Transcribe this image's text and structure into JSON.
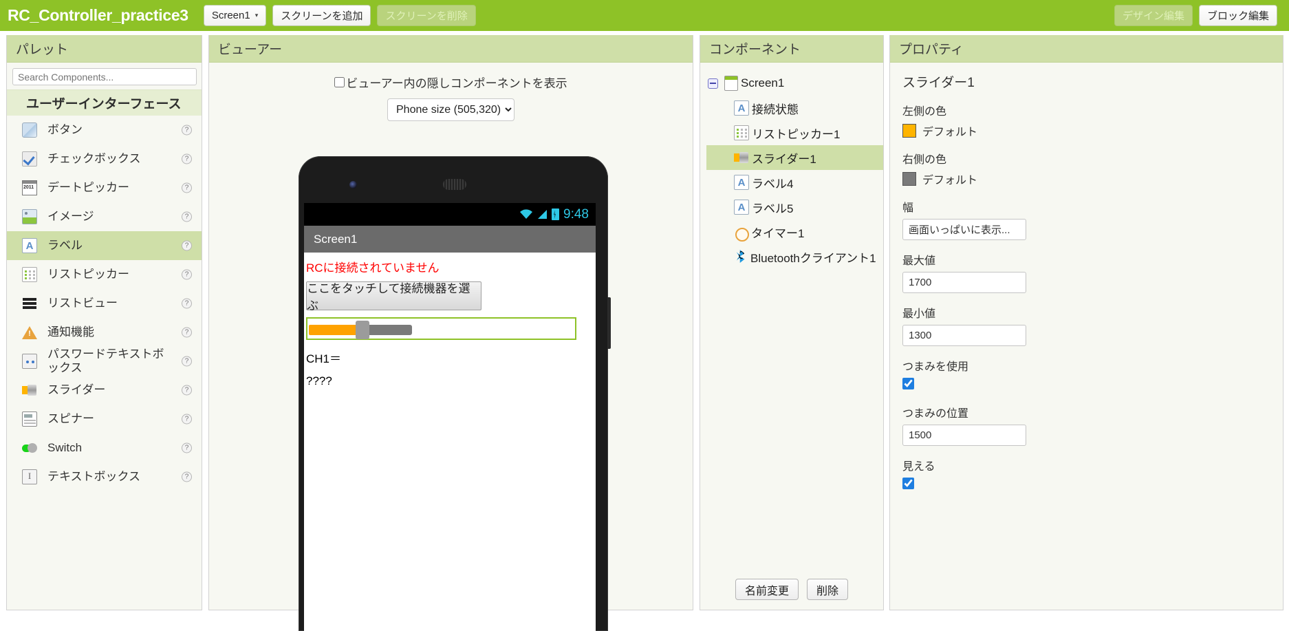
{
  "topbar": {
    "project_title": "RC_Controller_practice3",
    "screen_selector": "Screen1",
    "screen_caret": "▾",
    "add_screen": "スクリーンを追加",
    "remove_screen": "スクリーンを削除",
    "designer": "デザイン編集",
    "blocks": "ブロック編集",
    "bg_color": "#8ec227"
  },
  "palette": {
    "header": "パレット",
    "search_placeholder": "Search Components...",
    "search_value": "",
    "category": "ユーザーインターフェース",
    "help_glyph": "?",
    "items": [
      {
        "label": "ボタン",
        "icon": "button-icon",
        "selected": false
      },
      {
        "label": "チェックボックス",
        "icon": "checkbox-icon",
        "selected": false
      },
      {
        "label": "デートピッカー",
        "icon": "datepicker-icon",
        "selected": false
      },
      {
        "label": "イメージ",
        "icon": "image-icon",
        "selected": false
      },
      {
        "label": "ラベル",
        "icon": "label-icon",
        "selected": true
      },
      {
        "label": "リストピッカー",
        "icon": "listpicker-icon",
        "selected": false
      },
      {
        "label": "リストビュー",
        "icon": "listview-icon",
        "selected": false
      },
      {
        "label": "通知機能",
        "icon": "notifier-icon",
        "selected": false
      },
      {
        "label": "パスワードテキストボックス",
        "icon": "password-textbox-icon",
        "selected": false
      },
      {
        "label": "スライダー",
        "icon": "slider-icon",
        "selected": false
      },
      {
        "label": "スピナー",
        "icon": "spinner-icon",
        "selected": false
      },
      {
        "label": "Switch",
        "icon": "switch-icon",
        "selected": false
      },
      {
        "label": "テキストボックス",
        "icon": "textbox-icon",
        "selected": false
      }
    ]
  },
  "viewer": {
    "header": "ビューアー",
    "show_hidden_label": "ビューアー内の隠しコンポーネントを表示",
    "show_hidden_checked": false,
    "size_selected": "Phone size (505,320)",
    "size_options": [
      "Phone size (505,320)"
    ],
    "phone": {
      "statusbar_time": "9:48",
      "statusbar_accent": "#2ec8e6",
      "title": "Screen1",
      "connection_label": "RCに接続されていません",
      "connection_color": "#ff0000",
      "listpicker_button": "ここをタッチして接続機器を選ぶ",
      "label4": "CH1＝",
      "label5": "????",
      "slider_left_color": "#ffa200",
      "slider_right_color": "#7a7a7a",
      "slider_selected_outline": "#8ec227"
    }
  },
  "components": {
    "header": "コンポーネント",
    "tree": [
      {
        "label": "Screen1",
        "icon": "screen-icon",
        "selected": false,
        "depth": 0
      },
      {
        "label": "接続状態",
        "icon": "label-icon",
        "selected": false,
        "depth": 1
      },
      {
        "label": "リストピッカー1",
        "icon": "listpicker-icon",
        "selected": false,
        "depth": 1
      },
      {
        "label": "スライダー1",
        "icon": "slider-icon",
        "selected": true,
        "depth": 1
      },
      {
        "label": "ラベル4",
        "icon": "label-icon",
        "selected": false,
        "depth": 1
      },
      {
        "label": "ラベル5",
        "icon": "label-icon",
        "selected": false,
        "depth": 1
      },
      {
        "label": "タイマー1",
        "icon": "timer-icon",
        "selected": false,
        "depth": 1
      },
      {
        "label": "Bluetoothクライアント1",
        "icon": "bluetooth-icon",
        "selected": false,
        "depth": 1
      }
    ],
    "rename_button": "名前変更",
    "delete_button": "削除"
  },
  "properties": {
    "header": "プロパティ",
    "component_name": "スライダー1",
    "left_color_label": "左側の色",
    "left_color_value": "デフォルト",
    "left_color_hex": "#ffb400",
    "right_color_label": "右側の色",
    "right_color_value": "デフォルト",
    "right_color_hex": "#7a7a7a",
    "width_label": "幅",
    "width_value": "画面いっぱいに表示...",
    "max_label": "最大値",
    "max_value": "1700",
    "min_label": "最小値",
    "min_value": "1300",
    "thumb_enabled_label": "つまみを使用",
    "thumb_enabled": true,
    "thumb_position_label": "つまみの位置",
    "thumb_position_value": "1500",
    "visible_label": "見える",
    "visible": true
  }
}
